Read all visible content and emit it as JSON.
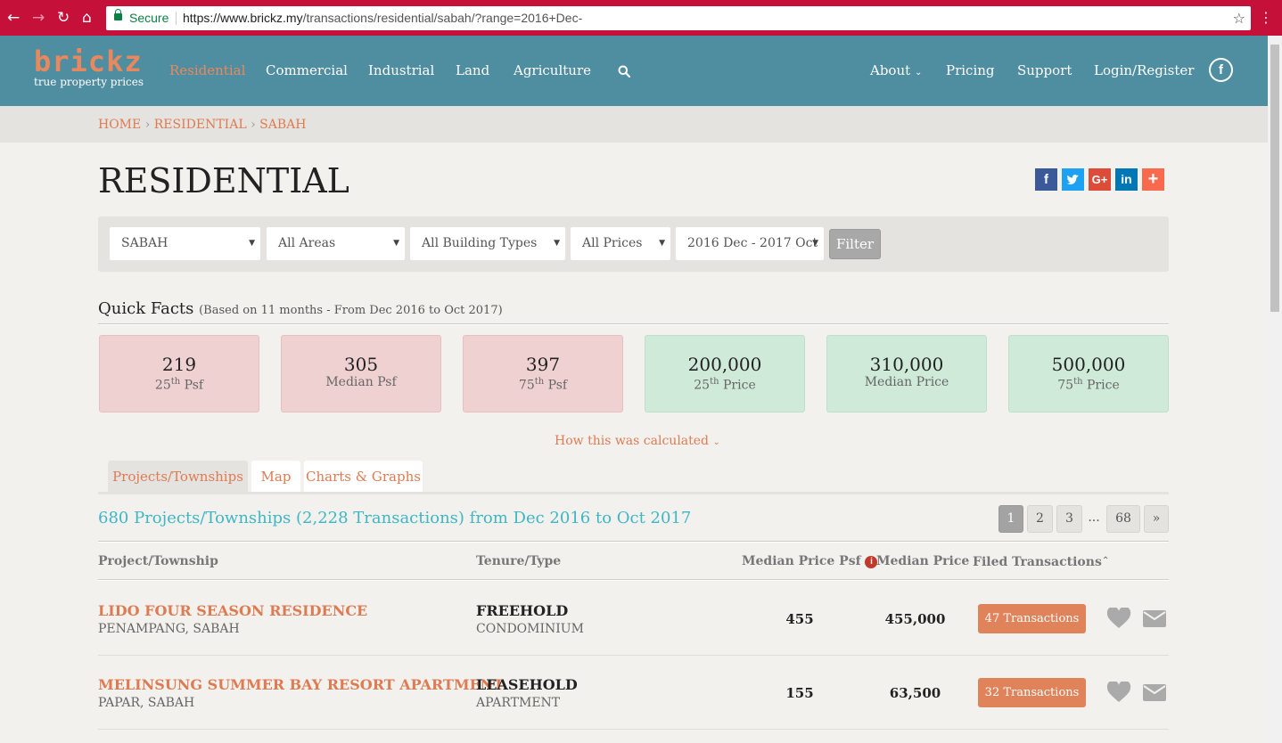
{
  "browser": {
    "secure_label": "Secure",
    "url_host": "https://www.brickz.my",
    "url_path": "/transactions/residential/sabah/?range=2016+Dec-"
  },
  "brand": {
    "name": "brickz",
    "tagline": "true property prices"
  },
  "nav": {
    "residential": "Residential",
    "commercial": "Commercial",
    "industrial": "Industrial",
    "land": "Land",
    "agriculture": "Agriculture",
    "about": "About",
    "pricing": "Pricing",
    "support": "Support",
    "login": "Login/Register"
  },
  "breadcrumb": {
    "home": "HOME",
    "residential": "RESIDENTIAL",
    "sabah": "SABAH",
    "separator": "›"
  },
  "page_title": "RESIDENTIAL",
  "filters": {
    "state": "SABAH",
    "area": "All Areas",
    "building_type": "All Building Types",
    "price": "All Prices",
    "range": "2016 Dec - 2017 Oct",
    "filter_button": "Filter"
  },
  "quick_facts": {
    "title": "Quick Facts",
    "subtitle": "(Based on 11 months - From Dec 2016 to Oct 2017)",
    "items": [
      {
        "value": "219",
        "label_pre": "25",
        "label_sup": "th",
        "label_post": " Psf"
      },
      {
        "value": "305",
        "label_pre": "Median Psf",
        "label_sup": "",
        "label_post": ""
      },
      {
        "value": "397",
        "label_pre": "75",
        "label_sup": "th",
        "label_post": " Psf"
      },
      {
        "value": "200,000",
        "label_pre": "25",
        "label_sup": "th",
        "label_post": " Price"
      },
      {
        "value": "310,000",
        "label_pre": "Median Price",
        "label_sup": "",
        "label_post": ""
      },
      {
        "value": "500,000",
        "label_pre": "75",
        "label_sup": "th",
        "label_post": " Price"
      }
    ],
    "how_link": "How this was calculated"
  },
  "tabs": {
    "projects": "Projects/Townships",
    "map": "Map",
    "charts": "Charts & Graphs"
  },
  "summary": "680 Projects/Townships (2,228 Transactions) from Dec 2016 to Oct 2017",
  "pagination": {
    "p1": "1",
    "p2": "2",
    "p3": "3",
    "ellipsis": "...",
    "last": "68",
    "next": "»"
  },
  "table": {
    "headers": {
      "project": "Project/Township",
      "tenure": "Tenure/Type",
      "median_psf": "Median Price Psf",
      "median_price": "Median Price",
      "filed": "Filed Transactions"
    },
    "rows": [
      {
        "name": "LIDO FOUR SEASON RESIDENCE",
        "location": "PENAMPANG, SABAH",
        "tenure": "FREEHOLD",
        "type": "CONDOMINIUM",
        "psf": "455",
        "price": "455,000",
        "transactions": "47 Transactions"
      },
      {
        "name": "MELINSUNG SUMMER BAY RESORT APARTMENT",
        "location": "PAPAR, SABAH",
        "tenure": "LEASEHOLD",
        "type": "APARTMENT",
        "psf": "155",
        "price": "63,500",
        "transactions": "32 Transactions"
      }
    ]
  },
  "colors": {
    "header": "#4f8da1",
    "accent": "#de7b52",
    "teal": "#3eb6c4",
    "chrome": "#c5113a"
  }
}
